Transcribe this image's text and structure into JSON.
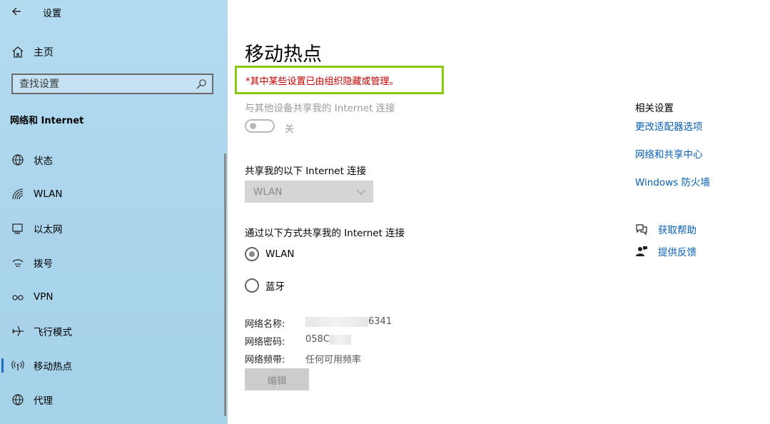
{
  "window": {
    "title": "设置"
  },
  "sidebar": {
    "home_label": "主页",
    "search": {
      "placeholder": "查找设置"
    },
    "section_title": "网络和 Internet",
    "items": [
      {
        "label": "状态",
        "icon": "globe-status-icon"
      },
      {
        "label": "WLAN",
        "icon": "wifi-icon"
      },
      {
        "label": "以太网",
        "icon": "ethernet-icon"
      },
      {
        "label": "拨号",
        "icon": "dialup-icon"
      },
      {
        "label": "VPN",
        "icon": "vpn-icon"
      },
      {
        "label": "飞行模式",
        "icon": "airplane-icon"
      },
      {
        "label": "移动热点",
        "icon": "hotspot-icon",
        "active": true
      },
      {
        "label": "代理",
        "icon": "globe-icon"
      }
    ]
  },
  "main": {
    "title": "移动热点",
    "policy_notice": "*其中某些设置已由组织隐藏或管理。",
    "share_label": "与其他设备共享我的 Internet 连接",
    "toggle_state": "关",
    "share_from_label": "共享我的以下 Internet 连接",
    "share_from_value": "WLAN",
    "share_over_label": "通过以下方式共享我的 Internet 连接",
    "share_over_options": [
      "WLAN",
      "蓝牙"
    ],
    "share_over_selected": "WLAN",
    "network_name_label": "网络名称:",
    "network_name_value": "6341",
    "network_password_label": "网络密码:",
    "network_password_value": "058C",
    "network_band_label": "网络频带:",
    "network_band_value": "任何可用频率",
    "edit_label": "编辑"
  },
  "related": {
    "heading": "相关设置",
    "links": [
      "更改适配器选项",
      "网络和共享中心",
      "Windows 防火墙"
    ],
    "help_label": "获取帮助",
    "feedback_label": "提供反馈"
  },
  "colors": {
    "sidebar_bg": "#a9d4ec",
    "link": "#0a5fb4",
    "notice_text": "#c40000",
    "notice_border": "#8acb12"
  }
}
